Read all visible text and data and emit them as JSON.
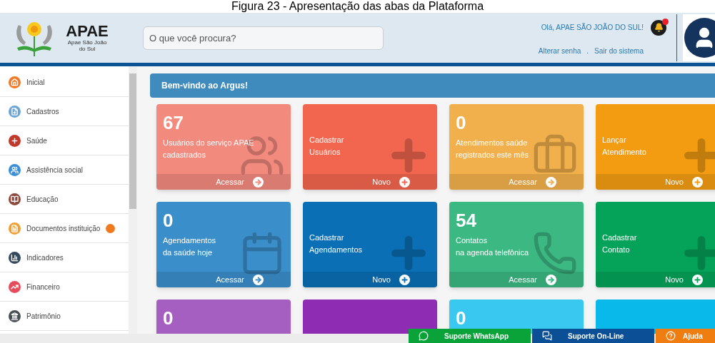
{
  "caption": "Figura 23 - Apresentação das abas da Plataforma",
  "header": {
    "logo_title": "APAE",
    "logo_subtitle": "Apae São João do Sul",
    "search": {
      "placeholder": "O que você procura?"
    },
    "greeting": "Olá, APAE SÃO JOÃO DO SUL!",
    "links": [
      "Alterar senha",
      "Sair do sistema"
    ],
    "link_separator": ".",
    "notifications": true
  },
  "sidebar": {
    "items": [
      {
        "label": "Inicial",
        "color": "#f07a28"
      },
      {
        "label": "Cadastros",
        "color": "#6aa5d6"
      },
      {
        "label": "Saúde",
        "color": "#c0392b"
      },
      {
        "label": "Assistência social",
        "color": "#3a8fd6"
      },
      {
        "label": "Educação",
        "color": "#8b4a3c"
      },
      {
        "label": "Documentos instituição",
        "color": "#f0a030",
        "new": true
      },
      {
        "label": "Indicadores",
        "color": "#34495e"
      },
      {
        "label": "Financeiro",
        "color": "#e74c5c"
      },
      {
        "label": "Patrimônio",
        "color": "#4a4f55"
      }
    ]
  },
  "welcome": "Bem-vindo ao Argus!",
  "tiles": [
    {
      "kind": "stat",
      "color": "#f28a7e",
      "number": "67",
      "lines": [
        "Usuários do serviço APAE",
        "cadastrados"
      ],
      "action": "Acessar"
    },
    {
      "kind": "new",
      "color": "#f2664f",
      "lines": [
        "Cadastrar",
        "Usuários"
      ],
      "action": "Novo"
    },
    {
      "kind": "stat",
      "color": "#f2b04c",
      "number": "0",
      "lines": [
        "Atendimentos saúde",
        "registrados este mês"
      ],
      "action": "Acessar"
    },
    {
      "kind": "new",
      "color": "#f39c12",
      "lines": [
        "Lançar",
        "Atendimento"
      ],
      "action": "Novo"
    },
    {
      "kind": "stat",
      "color": "#3a8fcb",
      "number": "0",
      "lines": [
        "Agendamentos",
        "da saúde hoje"
      ],
      "action": "Acessar"
    },
    {
      "kind": "new",
      "color": "#0b6fb5",
      "lines": [
        "Cadastrar",
        "Agendamentos"
      ],
      "action": "Novo"
    },
    {
      "kind": "stat",
      "color": "#3cb883",
      "number": "54",
      "lines": [
        "Contatos",
        "na agenda telefônica"
      ],
      "action": "Acessar"
    },
    {
      "kind": "new",
      "color": "#05a35a",
      "lines": [
        "Cadastrar",
        "Contato"
      ],
      "action": "Novo"
    },
    {
      "kind": "stat",
      "color": "#a45fc1",
      "number": "0"
    },
    {
      "kind": "new",
      "color": "#8e2db3"
    },
    {
      "kind": "stat",
      "color": "#39c8ef",
      "number": "0"
    },
    {
      "kind": "new",
      "color": "#08b9ea"
    }
  ],
  "support": [
    {
      "kind": "whatsapp",
      "label": "Suporte WhatsApp",
      "color": "#0aa33a"
    },
    {
      "kind": "chat",
      "label": "Suporte On-Line",
      "color": "#0b4f96"
    },
    {
      "kind": "help",
      "label": "Ajuda",
      "color": "#f07d10"
    }
  ]
}
